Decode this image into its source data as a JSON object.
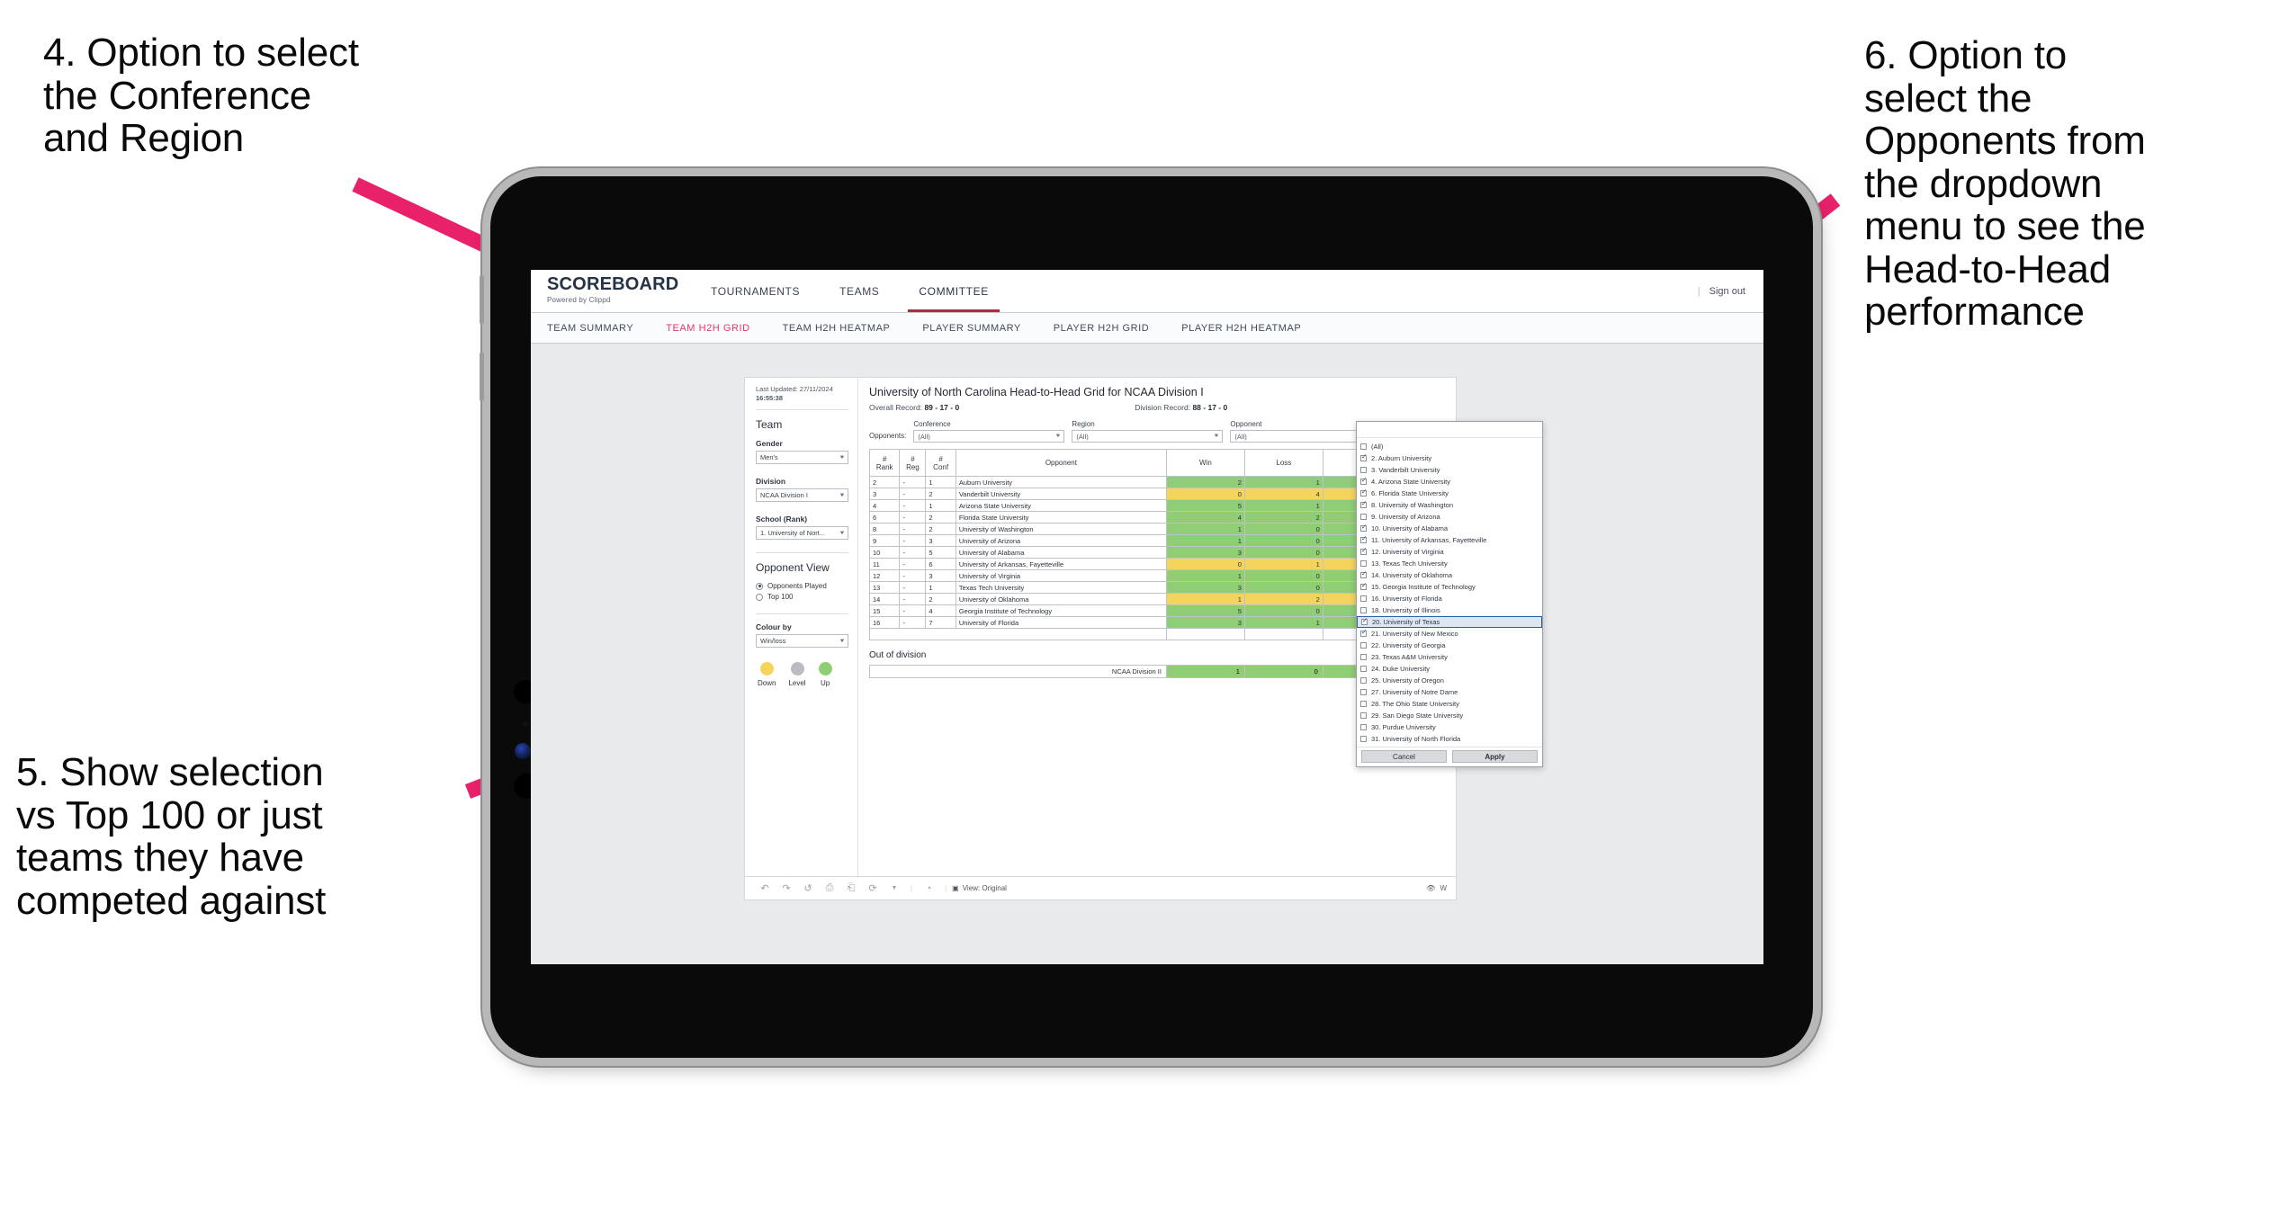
{
  "annotations": [
    {
      "id": "a4",
      "text": "4. Option to select\nthe Conference\nand Region"
    },
    {
      "id": "a5",
      "text": "5. Show selection\nvs Top 100 or just\nteams they have\ncompeted against"
    },
    {
      "id": "a6",
      "text": "6. Option to\nselect the\nOpponents from\nthe dropdown\nmenu to see the\nHead-to-Head\nperformance"
    }
  ],
  "colors": {
    "annotation_arrow": "#e8216a",
    "nav_active": "#b02a44",
    "subnav_active": "#e0396a",
    "cell_up": "#8fce74",
    "cell_down": "#f5d45e",
    "cell_level": "#b9bdc2",
    "selected_row": "#dde6f2",
    "selected_border": "#2d5f9e"
  },
  "header": {
    "brand_title": "SCOREBOARD",
    "brand_sub": "Powered by Clippd",
    "nav": [
      {
        "label": "TOURNAMENTS",
        "active": false
      },
      {
        "label": "TEAMS",
        "active": false
      },
      {
        "label": "COMMITTEE",
        "active": true
      }
    ],
    "separator": "|",
    "sign_out": "Sign out"
  },
  "subnav": [
    {
      "label": "TEAM SUMMARY",
      "active": false
    },
    {
      "label": "TEAM H2H GRID",
      "active": true
    },
    {
      "label": "TEAM H2H HEATMAP",
      "active": false
    },
    {
      "label": "PLAYER SUMMARY",
      "active": false
    },
    {
      "label": "PLAYER H2H GRID",
      "active": false
    },
    {
      "label": "PLAYER H2H HEATMAP",
      "active": false
    }
  ],
  "filter_pane": {
    "updated_label": "Last Updated: 27/11/2024",
    "updated_time": "16:55:38",
    "team_heading": "Team",
    "gender_label": "Gender",
    "gender_value": "Men's",
    "division_label": "Division",
    "division_value": "NCAA Division I",
    "school_label": "School (Rank)",
    "school_value": "1. University of Nort...",
    "opponent_view_heading": "Opponent View",
    "opponent_view_options": [
      {
        "label": "Opponents Played",
        "selected": true
      },
      {
        "label": "Top 100",
        "selected": false
      }
    ],
    "colour_by_label": "Colour by",
    "colour_by_value": "Win/loss",
    "legend": [
      {
        "label": "Down",
        "color": "#f5d45e"
      },
      {
        "label": "Level",
        "color": "#b9bdc2"
      },
      {
        "label": "Up",
        "color": "#8fce74"
      }
    ]
  },
  "viz": {
    "title": "University of North Carolina Head-to-Head Grid for NCAA Division I",
    "overall_record_label": "Overall Record:",
    "overall_record_value": "89 - 17 - 0",
    "division_record_label": "Division Record:",
    "division_record_value": "88 - 17 - 0",
    "opponents_label": "Opponents:",
    "filters": [
      {
        "label": "Conference",
        "value": "(All)"
      },
      {
        "label": "Region",
        "value": "(All)"
      },
      {
        "label": "Opponent",
        "value": "(All)"
      }
    ],
    "table": {
      "headers": [
        "# Rank",
        "# Reg",
        "# Conf",
        "Opponent",
        "Win",
        "Loss",
        ""
      ],
      "rows": [
        {
          "rank": "2",
          "reg": "-",
          "conf": "1",
          "opponent": "Auburn University",
          "win": "2",
          "loss": "1",
          "state": "up"
        },
        {
          "rank": "3",
          "reg": "-",
          "conf": "2",
          "opponent": "Vanderbilt University",
          "win": "0",
          "loss": "4",
          "state": "down"
        },
        {
          "rank": "4",
          "reg": "-",
          "conf": "1",
          "opponent": "Arizona State University",
          "win": "5",
          "loss": "1",
          "state": "up"
        },
        {
          "rank": "6",
          "reg": "-",
          "conf": "2",
          "opponent": "Florida State University",
          "win": "4",
          "loss": "2",
          "state": "up"
        },
        {
          "rank": "8",
          "reg": "-",
          "conf": "2",
          "opponent": "University of Washington",
          "win": "1",
          "loss": "0",
          "state": "up"
        },
        {
          "rank": "9",
          "reg": "-",
          "conf": "3",
          "opponent": "University of Arizona",
          "win": "1",
          "loss": "0",
          "state": "up"
        },
        {
          "rank": "10",
          "reg": "-",
          "conf": "5",
          "opponent": "University of Alabama",
          "win": "3",
          "loss": "0",
          "state": "up"
        },
        {
          "rank": "11",
          "reg": "-",
          "conf": "6",
          "opponent": "University of Arkansas, Fayetteville",
          "win": "0",
          "loss": "1",
          "state": "down"
        },
        {
          "rank": "12",
          "reg": "-",
          "conf": "3",
          "opponent": "University of Virginia",
          "win": "1",
          "loss": "0",
          "state": "up"
        },
        {
          "rank": "13",
          "reg": "-",
          "conf": "1",
          "opponent": "Texas Tech University",
          "win": "3",
          "loss": "0",
          "state": "up"
        },
        {
          "rank": "14",
          "reg": "-",
          "conf": "2",
          "opponent": "University of Oklahoma",
          "win": "1",
          "loss": "2",
          "state": "down"
        },
        {
          "rank": "15",
          "reg": "-",
          "conf": "4",
          "opponent": "Georgia Institute of Technology",
          "win": "5",
          "loss": "0",
          "state": "up"
        },
        {
          "rank": "16",
          "reg": "-",
          "conf": "7",
          "opponent": "University of Florida",
          "win": "3",
          "loss": "1",
          "state": "up"
        }
      ]
    },
    "out_of_division": {
      "title": "Out of division",
      "rows": [
        {
          "name": "NCAA Division II",
          "win": "1",
          "loss": "0",
          "state": "up"
        }
      ]
    },
    "toolbar": {
      "icons": [
        "undo-icon",
        "redo-icon",
        "revert-icon",
        "save-icon",
        "pause-icon",
        "refresh-icon",
        "chevron-down-icon",
        "clock-icon"
      ],
      "view_label": "View: Original",
      "right_label": "W"
    }
  },
  "opponent_dropdown": {
    "options": [
      {
        "label": "(All)",
        "checked": false,
        "selected": false
      },
      {
        "label": "2. Auburn University",
        "checked": true,
        "selected": false
      },
      {
        "label": "3. Vanderbilt University",
        "checked": false,
        "selected": false
      },
      {
        "label": "4. Arizona State University",
        "checked": true,
        "selected": false
      },
      {
        "label": "6. Florida State University",
        "checked": true,
        "selected": false
      },
      {
        "label": "8. University of Washington",
        "checked": true,
        "selected": false
      },
      {
        "label": "9. University of Arizona",
        "checked": false,
        "selected": false
      },
      {
        "label": "10. University of Alabama",
        "checked": true,
        "selected": false
      },
      {
        "label": "11. University of Arkansas, Fayetteville",
        "checked": true,
        "selected": false
      },
      {
        "label": "12. University of Virginia",
        "checked": true,
        "selected": false
      },
      {
        "label": "13. Texas Tech University",
        "checked": false,
        "selected": false
      },
      {
        "label": "14. University of Oklahoma",
        "checked": true,
        "selected": false
      },
      {
        "label": "15. Georgia Institute of Technology",
        "checked": true,
        "selected": false
      },
      {
        "label": "16. University of Florida",
        "checked": false,
        "selected": false
      },
      {
        "label": "18. University of Illinois",
        "checked": false,
        "selected": false
      },
      {
        "label": "20. University of Texas",
        "checked": true,
        "selected": true
      },
      {
        "label": "21. University of New Mexico",
        "checked": true,
        "selected": false
      },
      {
        "label": "22. University of Georgia",
        "checked": false,
        "selected": false
      },
      {
        "label": "23. Texas A&M University",
        "checked": false,
        "selected": false
      },
      {
        "label": "24. Duke University",
        "checked": false,
        "selected": false
      },
      {
        "label": "25. University of Oregon",
        "checked": false,
        "selected": false
      },
      {
        "label": "27. University of Notre Dame",
        "checked": false,
        "selected": false
      },
      {
        "label": "28. The Ohio State University",
        "checked": false,
        "selected": false
      },
      {
        "label": "29. San Diego State University",
        "checked": false,
        "selected": false
      },
      {
        "label": "30. Purdue University",
        "checked": false,
        "selected": false
      },
      {
        "label": "31. University of North Florida",
        "checked": false,
        "selected": false
      }
    ],
    "cancel_label": "Cancel",
    "apply_label": "Apply"
  }
}
